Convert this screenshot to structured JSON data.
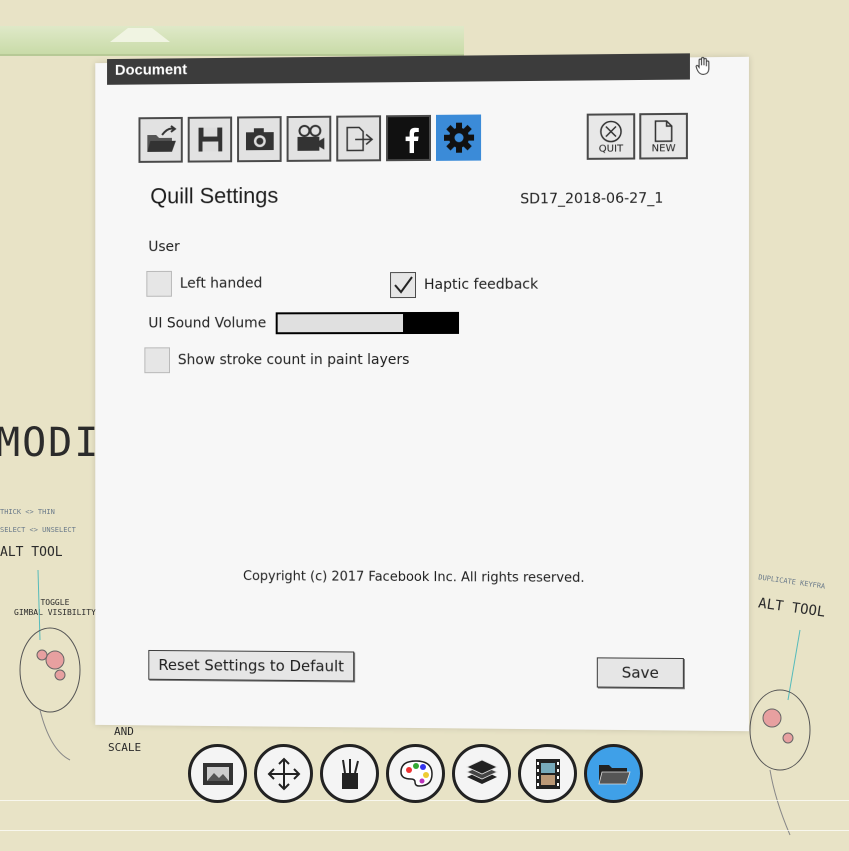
{
  "window": {
    "title": "Document"
  },
  "toolbar": {
    "items": [
      {
        "icon": "open-folder-icon"
      },
      {
        "icon": "save-disk-icon"
      },
      {
        "icon": "camera-icon"
      },
      {
        "icon": "film-camera-icon"
      },
      {
        "icon": "export-icon"
      },
      {
        "icon": "facebook-icon"
      },
      {
        "icon": "settings-gear-icon",
        "active": true
      }
    ],
    "quit_label": "QUIT",
    "new_label": "NEW"
  },
  "settings": {
    "heading": "Quill Settings",
    "document_name": "SD17_2018-06-27_1",
    "section_user": "User",
    "left_handed": {
      "label": "Left handed",
      "checked": false
    },
    "haptic_feedback": {
      "label": "Haptic feedback",
      "checked": true
    },
    "ui_sound_volume": {
      "label": "UI Sound Volume",
      "value": 0.7
    },
    "stroke_count": {
      "label": "Show stroke count in paint layers",
      "checked": false
    },
    "copyright": "Copyright (c) 2017 Facebook Inc. All rights reserved.",
    "reset_label": "Reset Settings to Default",
    "save_label": "Save"
  },
  "background": {
    "mode_text": "MODI",
    "alt_tool_left": "ALT TOOL",
    "alt_tool_right": "ALT TOOL",
    "toggle_text": "TOGGLE",
    "gimbal_text": "GIMBAL VISIBILITY",
    "and_text": "AND",
    "scale_text": "SCALE",
    "thick_text": "THICK <> THIN",
    "select_text": "SELECT <> UNSELECT",
    "duplicate_text": "DUPLICATE KEYFRA"
  },
  "dock": {
    "items": [
      {
        "icon": "picture-frame-icon"
      },
      {
        "icon": "move-arrows-icon"
      },
      {
        "icon": "brushes-icon"
      },
      {
        "icon": "color-palette-icon"
      },
      {
        "icon": "layers-icon"
      },
      {
        "icon": "film-frames-icon"
      },
      {
        "icon": "folder-icon",
        "active": true
      }
    ]
  },
  "colors": {
    "accent": "#3b8bd8",
    "titlebar": "#3c3c3c",
    "background": "#e8e3c6"
  }
}
